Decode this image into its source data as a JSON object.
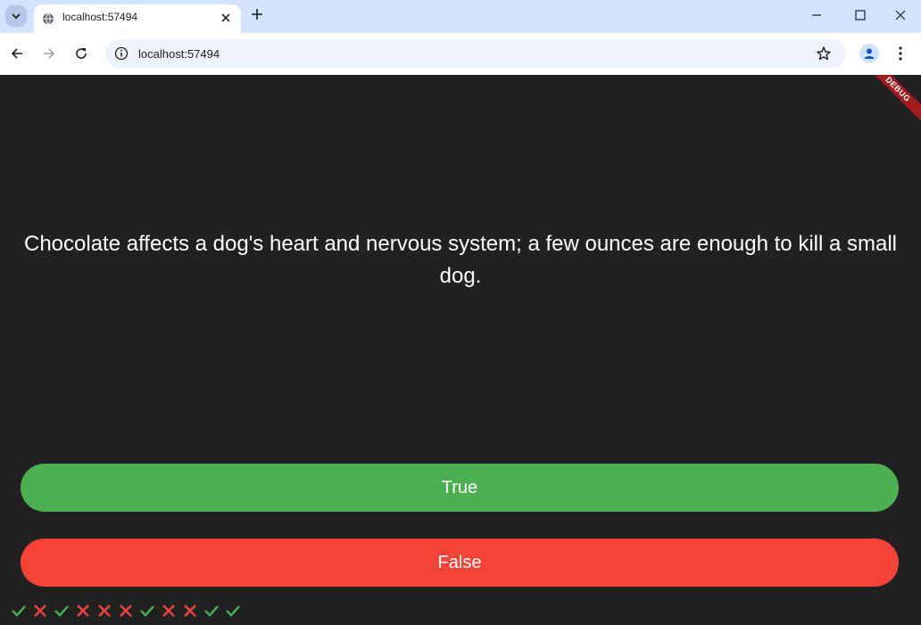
{
  "browser": {
    "tab_title": "localhost:57494",
    "url": "localhost:57494"
  },
  "app": {
    "debug_label": "DEBUG",
    "question": "Chocolate affects a dog's heart and nervous system; a few ounces are enough to kill a small dog.",
    "true_label": "True",
    "false_label": "False",
    "score_keeper": [
      "check",
      "cross",
      "check",
      "cross",
      "cross",
      "cross",
      "check",
      "cross",
      "cross",
      "check",
      "check"
    ],
    "colors": {
      "background": "#212121",
      "true": "#4caf50",
      "false": "#f44336",
      "check": "#4caf50",
      "cross": "#f44336"
    }
  }
}
